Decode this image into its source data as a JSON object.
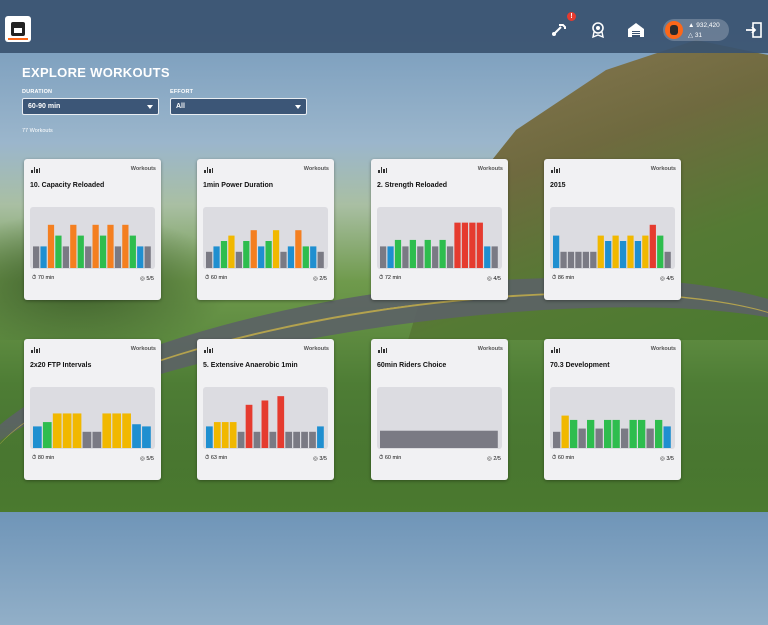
{
  "header": {
    "notification_badge": "!",
    "profile": {
      "drops": "932,420",
      "level": "31"
    }
  },
  "page": {
    "title": "EXPLORE WORKOUTS",
    "duration_label": "DURATION",
    "duration_value": "60-90 min",
    "effort_label": "EFFORT",
    "effort_value": "All",
    "result_count": "77 Workouts"
  },
  "colors": {
    "accent": "#fc6719",
    "topbar": "#3a5270",
    "card": "#f1f1f3"
  },
  "icons": [
    "logo-icon",
    "tools-icon",
    "badge-icon",
    "garage-icon",
    "exit-icon",
    "clock-icon",
    "effort-icon",
    "bar-chart-icon"
  ],
  "cards": [
    {
      "type": "Workouts",
      "name": "10. Capacity Reloaded",
      "duration": "70 min",
      "effort": "5/5",
      "profile": [
        [
          "#7a7a84",
          2
        ],
        [
          "#1f8fd0",
          2
        ],
        [
          "#f47f20",
          4
        ],
        [
          "#2ebd4e",
          3
        ],
        [
          "#7a7a84",
          2
        ],
        [
          "#f47f20",
          4
        ],
        [
          "#2ebd4e",
          3
        ],
        [
          "#7a7a84",
          2
        ],
        [
          "#f47f20",
          4
        ],
        [
          "#2ebd4e",
          3
        ],
        [
          "#f47f20",
          4
        ],
        [
          "#7a7a84",
          2
        ],
        [
          "#f47f20",
          4
        ],
        [
          "#2ebd4e",
          3
        ],
        [
          "#1f8fd0",
          2
        ],
        [
          "#7a7a84",
          2
        ]
      ]
    },
    {
      "type": "Workouts",
      "name": "1min Power Duration",
      "duration": "60 min",
      "effort": "2/5",
      "profile": [
        [
          "#7a7a84",
          1.5
        ],
        [
          "#1f8fd0",
          2
        ],
        [
          "#2ebd4e",
          2.5
        ],
        [
          "#f1b800",
          3
        ],
        [
          "#7a7a84",
          1.5
        ],
        [
          "#2ebd4e",
          2.5
        ],
        [
          "#f47f20",
          3.5
        ],
        [
          "#1f8fd0",
          2
        ],
        [
          "#2ebd4e",
          2.5
        ],
        [
          "#f1b800",
          3.5
        ],
        [
          "#7a7a84",
          1.5
        ],
        [
          "#1f8fd0",
          2
        ],
        [
          "#f47f20",
          3.5
        ],
        [
          "#2ebd4e",
          2
        ],
        [
          "#1f8fd0",
          2
        ],
        [
          "#7a7a84",
          1.5
        ]
      ]
    },
    {
      "type": "Workouts",
      "name": "2. Strength Reloaded",
      "duration": "72 min",
      "effort": "4/5",
      "profile": [
        [
          "#7a7a84",
          2
        ],
        [
          "#1f8fd0",
          2
        ],
        [
          "#2ebd4e",
          2.6
        ],
        [
          "#7a7a84",
          2
        ],
        [
          "#2ebd4e",
          2.6
        ],
        [
          "#7a7a84",
          2
        ],
        [
          "#2ebd4e",
          2.6
        ],
        [
          "#7a7a84",
          2
        ],
        [
          "#2ebd4e",
          2.6
        ],
        [
          "#7a7a84",
          2
        ],
        [
          "#e53b2f",
          4.2
        ],
        [
          "#e53b2f",
          4.2
        ],
        [
          "#e53b2f",
          4.2
        ],
        [
          "#e53b2f",
          4.2
        ],
        [
          "#1f8fd0",
          2
        ],
        [
          "#7a7a84",
          2
        ]
      ]
    },
    {
      "type": "Workouts",
      "name": "2015",
      "duration": "86 min",
      "effort": "4/5",
      "profile": [
        [
          "#1f8fd0",
          3
        ],
        [
          "#7a7a84",
          1.5
        ],
        [
          "#7a7a84",
          1.5
        ],
        [
          "#7a7a84",
          1.5
        ],
        [
          "#7a7a84",
          1.5
        ],
        [
          "#7a7a84",
          1.5
        ],
        [
          "#f1b800",
          3
        ],
        [
          "#1f8fd0",
          2.5
        ],
        [
          "#f1b800",
          3
        ],
        [
          "#1f8fd0",
          2.5
        ],
        [
          "#f1b800",
          3
        ],
        [
          "#1f8fd0",
          2.5
        ],
        [
          "#f1b800",
          3
        ],
        [
          "#e53b2f",
          4
        ],
        [
          "#2ebd4e",
          3
        ],
        [
          "#7a7a84",
          1.5
        ]
      ]
    },
    {
      "type": "Workouts",
      "name": "2x20 FTP Intervals",
      "duration": "80 min",
      "effort": "5/5",
      "profile": [
        [
          "#1f8fd0",
          2
        ],
        [
          "#2ebd4e",
          2.4
        ],
        [
          "#f1b800",
          3.2
        ],
        [
          "#f1b800",
          3.2
        ],
        [
          "#f1b800",
          3.2
        ],
        [
          "#7a7a84",
          1.5
        ],
        [
          "#7a7a84",
          1.5
        ],
        [
          "#f1b800",
          3.2
        ],
        [
          "#f1b800",
          3.2
        ],
        [
          "#f1b800",
          3.2
        ],
        [
          "#1f8fd0",
          2.2
        ],
        [
          "#1f8fd0",
          2
        ]
      ]
    },
    {
      "type": "Workouts",
      "name": "5. Extensive Anaerobic 1min",
      "duration": "63 min",
      "effort": "3/5",
      "profile": [
        [
          "#1f8fd0",
          2
        ],
        [
          "#f1b800",
          2.4
        ],
        [
          "#f1b800",
          2.4
        ],
        [
          "#f1b800",
          2.4
        ],
        [
          "#7a7a84",
          1.5
        ],
        [
          "#e53b2f",
          4
        ],
        [
          "#7a7a84",
          1.5
        ],
        [
          "#e53b2f",
          4.4
        ],
        [
          "#7a7a84",
          1.5
        ],
        [
          "#e53b2f",
          4.8
        ],
        [
          "#7a7a84",
          1.5
        ],
        [
          "#7a7a84",
          1.5
        ],
        [
          "#7a7a84",
          1.5
        ],
        [
          "#7a7a84",
          1.5
        ],
        [
          "#1f8fd0",
          2
        ]
      ]
    },
    {
      "type": "Workouts",
      "name": "60min Riders Choice",
      "duration": "60 min",
      "effort": "2/5",
      "profile": [
        [
          "#7a7a84",
          1.6
        ]
      ]
    },
    {
      "type": "Workouts",
      "name": "70.3 Development",
      "duration": "60 min",
      "effort": "3/5",
      "profile": [
        [
          "#7a7a84",
          1.5
        ],
        [
          "#f1b800",
          3
        ],
        [
          "#2ebd4e",
          2.6
        ],
        [
          "#7a7a84",
          1.8
        ],
        [
          "#2ebd4e",
          2.6
        ],
        [
          "#7a7a84",
          1.8
        ],
        [
          "#2ebd4e",
          2.6
        ],
        [
          "#2ebd4e",
          2.6
        ],
        [
          "#7a7a84",
          1.8
        ],
        [
          "#2ebd4e",
          2.6
        ],
        [
          "#2ebd4e",
          2.6
        ],
        [
          "#7a7a84",
          1.8
        ],
        [
          "#2ebd4e",
          2.6
        ],
        [
          "#1f8fd0",
          2
        ]
      ]
    }
  ]
}
